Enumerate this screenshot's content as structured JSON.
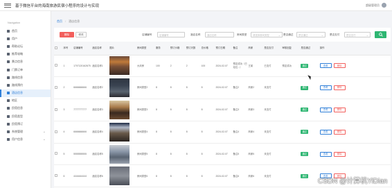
{
  "app": {
    "title": "基于微信平台的海南旅游民宿小程序的设计与实现",
    "user": "超级管理员"
  },
  "sidebar": {
    "heading": "Navigation",
    "items": [
      {
        "label": "首页",
        "icon": "home-icon"
      },
      {
        "label": "用户",
        "icon": "user-icon"
      },
      {
        "label": "帮助论坛",
        "icon": "forum-icon"
      },
      {
        "label": "推荐攻略",
        "icon": "guide-icon"
      },
      {
        "label": "景点信息",
        "icon": "scenic-icon"
      },
      {
        "label": "门票订单",
        "icon": "ticket-icon"
      },
      {
        "label": "路线信息",
        "icon": "route-icon"
      },
      {
        "label": "路线预约",
        "icon": "booking-icon"
      },
      {
        "label": "酒店信息",
        "icon": "hotel-icon",
        "active": true
      },
      {
        "label": "地区",
        "icon": "region-icon"
      },
      {
        "label": "民宿信息",
        "icon": "homestay-icon"
      },
      {
        "label": "民宿类型",
        "icon": "type-icon"
      },
      {
        "label": "民宿预订",
        "icon": "reserve-icon"
      },
      {
        "label": "系统管理",
        "icon": "settings-icon",
        "expandable": true
      },
      {
        "label": "用户信息",
        "icon": "profile-icon",
        "expandable": true
      }
    ]
  },
  "breadcrumb": {
    "home": "首页",
    "current": "酒店信息"
  },
  "toolbar": {
    "delete_label": "删除",
    "modify_label": "修改",
    "fields": [
      {
        "label": "店铺编号",
        "placeholder": "店铺编号"
      },
      {
        "label": "酒店名称",
        "placeholder": "酒店名称"
      },
      {
        "label": "房间类型",
        "placeholder": "请选择房间类型"
      },
      {
        "label": "是否通过",
        "placeholder": "是否通过"
      },
      {
        "label": "是否支付",
        "placeholder": "是否支付"
      }
    ]
  },
  "table": {
    "columns": [
      "序号",
      "店铺编号",
      "酒店名称",
      "图片",
      "房间类型",
      "服务",
      "预订价格",
      "预订天数",
      "总价格",
      "预订日期",
      "备注",
      "商家",
      "是否支付",
      "审核回复",
      "是否通过",
      "操作"
    ],
    "view_label": "查看",
    "delete_label": "删除",
    "rows": [
      {
        "index": "1",
        "shop_no": "1707120162675",
        "name": "酒店名称1",
        "room_type": "大床房",
        "service": "100",
        "price": "2",
        "days": "2",
        "total": "100",
        "date": "2024-02-07",
        "note": "预定成功（已站位...）",
        "merchant": "王某",
        "paid": "已支付",
        "reply": "预定成功",
        "approved": "通过"
      },
      {
        "index": "2",
        "shop_no": "6666666666",
        "name": "酒店名称2",
        "room_type": "房间类型2",
        "service": "8",
        "price": "8",
        "days": "8",
        "total": "8",
        "date": "2024-02-07",
        "note": "备注2",
        "merchant": "商家2",
        "paid": "未支付",
        "reply": "",
        "approved": "通过"
      },
      {
        "index": "3",
        "shop_no": "7777777777",
        "name": "酒店名称3",
        "room_type": "房间类型3",
        "service": "8",
        "price": "8",
        "days": "8",
        "total": "8",
        "date": "2024-02-07",
        "note": "备注3",
        "merchant": "商家3",
        "paid": "未支付",
        "reply": "",
        "approved": "通过"
      },
      {
        "index": "4",
        "shop_no": "6666666666",
        "name": "酒店名称4",
        "room_type": "房间类型4",
        "service": "8",
        "price": "8",
        "days": "8",
        "total": "8",
        "date": "2024-02-07",
        "note": "备注4",
        "merchant": "商家4",
        "paid": "未支付",
        "reply": "",
        "approved": "通过"
      },
      {
        "index": "5",
        "shop_no": "5555555555",
        "name": "酒店名称5",
        "room_type": "房间类型5",
        "service": "8",
        "price": "8",
        "days": "8",
        "total": "8",
        "date": "2024-02-07",
        "note": "备注5",
        "merchant": "商家5",
        "paid": "未支付",
        "reply": "",
        "approved": "通过"
      },
      {
        "index": "6",
        "shop_no": "4444444444",
        "name": "酒店名称6",
        "room_type": "房间类型6",
        "service": "8",
        "price": "8",
        "days": "8",
        "total": "8",
        "date": "2024-02-07",
        "note": "备注6",
        "merchant": "商家6",
        "paid": "未支付",
        "reply": "",
        "approved": "通过"
      }
    ]
  },
  "watermark": "CSDN @计算机YiDian",
  "colors": {
    "primary": "#2f7fd8",
    "success": "#2eb672",
    "danger": "#f25f5c"
  }
}
